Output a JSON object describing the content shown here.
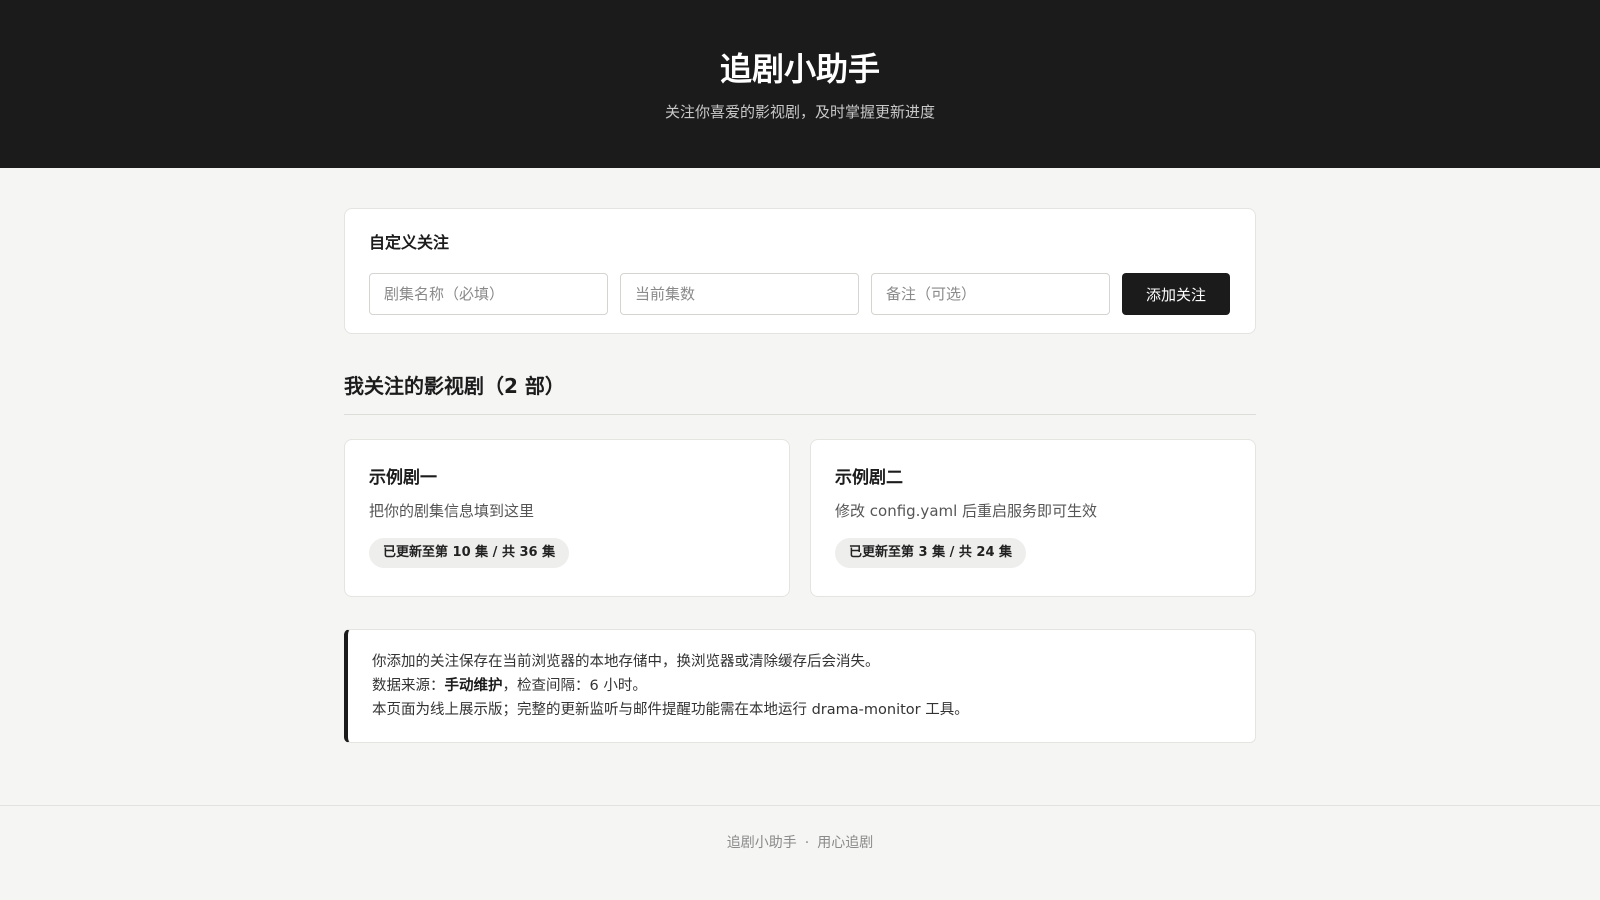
{
  "header": {
    "title": "追剧小助手",
    "subtitle": "关注你喜爱的影视剧，及时掌握更新进度"
  },
  "add_form": {
    "title": "自定义关注",
    "name_placeholder": "剧集名称（必填）",
    "episodes_placeholder": "当前集数",
    "note_placeholder": "备注（可选）",
    "submit_label": "添加关注"
  },
  "list": {
    "title": "我关注的影视剧（2 部）",
    "dramas": [
      {
        "name": "示例剧一",
        "note": "把你的剧集信息填到这里",
        "progress": "已更新至第 10 集 / 共 36 集"
      },
      {
        "name": "示例剧二",
        "note": "修改 config.yaml 后重启服务即可生效",
        "progress": "已更新至第 3 集 / 共 24 集"
      }
    ]
  },
  "info": {
    "line1": "你添加的关注保存在当前浏览器的本地存储中，换浏览器或清除缓存后会消失。",
    "line2_prefix": "数据来源：",
    "line2_source": "手动维护",
    "line2_suffix": "，检查间隔：6 小时。",
    "line3": "本页面为线上展示版；完整的更新监听与邮件提醒功能需在本地运行 drama-monitor 工具。"
  },
  "footer": {
    "app_name": "追剧小助手",
    "separator": "·",
    "slogan": "用心追剧"
  }
}
